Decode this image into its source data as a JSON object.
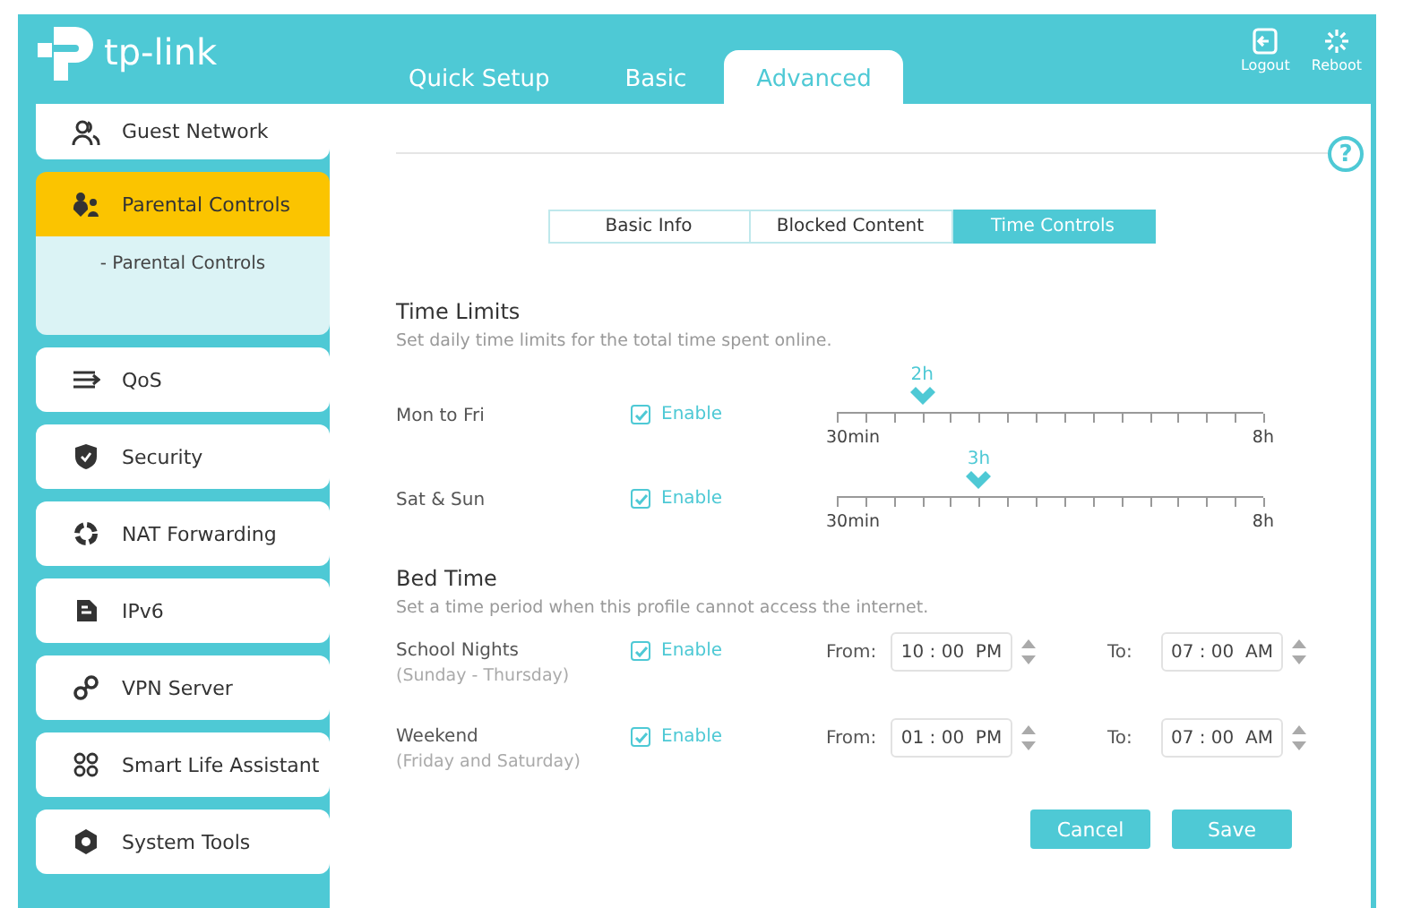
{
  "header": {
    "logo": "tp-link",
    "tabs": [
      {
        "label": "Quick Setup",
        "selected": false
      },
      {
        "label": "Basic",
        "selected": false
      },
      {
        "label": "Advanced",
        "selected": true
      }
    ],
    "actions": [
      {
        "label": "Logout"
      },
      {
        "label": "Reboot"
      }
    ]
  },
  "sidebar": {
    "items": [
      {
        "label": "Guest Network",
        "selected": false
      },
      {
        "label": "Parental Controls",
        "selected": true,
        "children": [
          {
            "label": "- Parental Controls",
            "selected": false
          }
        ]
      },
      {
        "label": "QoS",
        "selected": false
      },
      {
        "label": "Security",
        "selected": false
      },
      {
        "label": "NAT Forwarding",
        "selected": false
      },
      {
        "label": "IPv6",
        "selected": false
      },
      {
        "label": "VPN Server",
        "selected": false
      },
      {
        "label": "Smart Life Assistant",
        "selected": false
      },
      {
        "label": "System Tools",
        "selected": false
      }
    ]
  },
  "help": "?",
  "sub_tabs": [
    {
      "label": "Basic Info",
      "selected": false
    },
    {
      "label": "Blocked Content",
      "selected": false
    },
    {
      "label": "Time Controls",
      "selected": true
    }
  ],
  "time_limits": {
    "title": "Time Limits",
    "description": "Set daily time limits for the total time spent online.",
    "rows": [
      {
        "label": "Mon to Fri",
        "enabled": true,
        "enable_label": "Enable",
        "value_label": "2h",
        "level": 0.2,
        "min_label": "30min",
        "max_label": "8h"
      },
      {
        "label": "Sat & Sun",
        "enabled": true,
        "enable_label": "Enable",
        "value_label": "3h",
        "level": 0.333,
        "min_label": "30min",
        "max_label": "8h"
      }
    ]
  },
  "bed_time": {
    "title": "Bed Time",
    "description": "Set a time period when this profile cannot access the internet.",
    "rows": [
      {
        "label": "School Nights",
        "sublabel": "(Sunday - Thursday)",
        "enabled": true,
        "enable_label": "Enable",
        "from_label": "From:",
        "from": "10 : 00  PM",
        "to_label": "To:",
        "to": "07 : 00  AM"
      },
      {
        "label": "Weekend",
        "sublabel": "(Friday and Saturday)",
        "enabled": true,
        "enable_label": "Enable",
        "from_label": "From:",
        "from": "01 : 00  PM",
        "to_label": "To:",
        "to": "07 : 00  AM"
      }
    ]
  },
  "buttons": [
    "Cancel",
    "Save"
  ]
}
